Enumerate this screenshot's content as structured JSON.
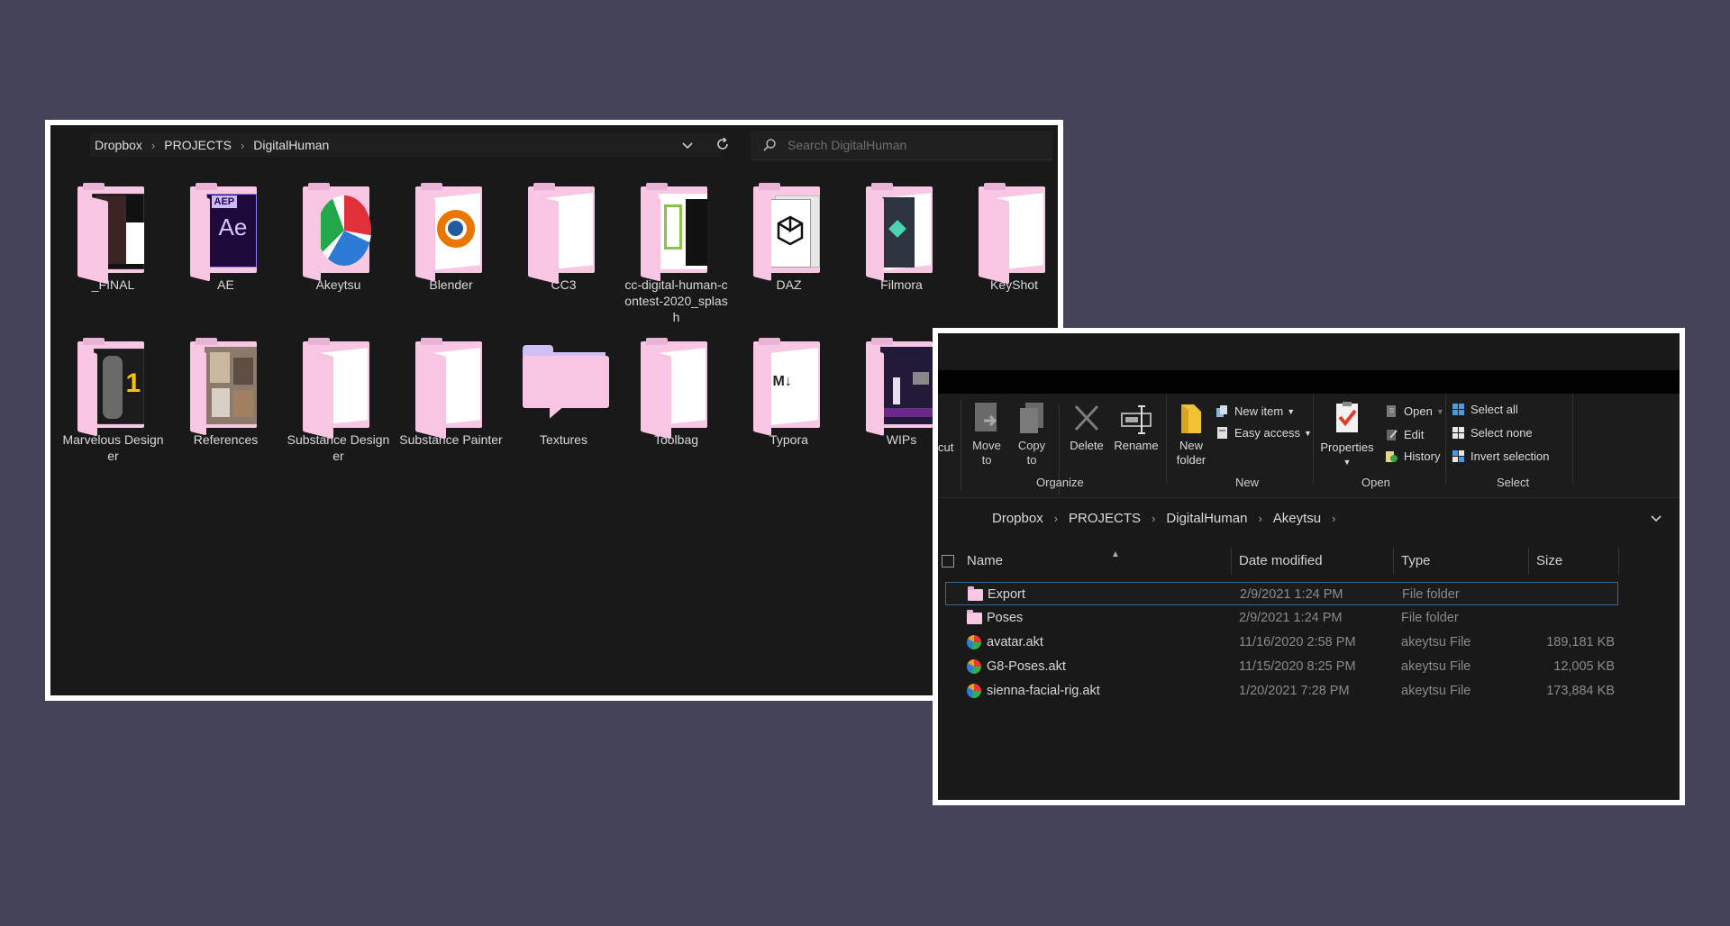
{
  "window1": {
    "breadcrumb": [
      "Dropbox",
      "PROJECTS",
      "DigitalHuman"
    ],
    "search_placeholder": "Search DigitalHuman",
    "folders": [
      {
        "label": "_FINAL",
        "icon": "folder-final-icon"
      },
      {
        "label": "AE",
        "icon": "folder-after-effects-icon"
      },
      {
        "label": "Akeytsu",
        "icon": "folder-akeytsu-icon"
      },
      {
        "label": "Blender",
        "icon": "folder-blender-icon"
      },
      {
        "label": "CC3",
        "icon": "folder-icon"
      },
      {
        "label": "cc-digital-human-contest-2020_splash",
        "icon": "folder-cc-icon"
      },
      {
        "label": "DAZ",
        "icon": "folder-daz-icon"
      },
      {
        "label": "Filmora",
        "icon": "folder-filmora-icon"
      },
      {
        "label": "KeyShot",
        "icon": "folder-icon"
      },
      {
        "label": "Marvelous Designer",
        "icon": "folder-marvelous-icon"
      },
      {
        "label": "References",
        "icon": "folder-references-icon"
      },
      {
        "label": "Substance Designer",
        "icon": "folder-icon"
      },
      {
        "label": "Substance Painter",
        "icon": "folder-icon"
      },
      {
        "label": "Textures",
        "icon": "folder-empty-icon"
      },
      {
        "label": "Toolbag",
        "icon": "folder-icon"
      },
      {
        "label": "Typora",
        "icon": "folder-markdown-icon"
      },
      {
        "label": "WIPs",
        "icon": "folder-wips-icon"
      }
    ]
  },
  "window2": {
    "ribbon": {
      "cut_label": "cut",
      "move_to": "Move\nto",
      "copy_to": "Copy\nto",
      "delete": "Delete",
      "rename": "Rename",
      "new_folder": "New\nfolder",
      "new_item": "New item",
      "easy_access": "Easy access",
      "properties": "Properties",
      "open": "Open",
      "edit": "Edit",
      "history": "History",
      "select_all": "Select all",
      "select_none": "Select none",
      "invert_selection": "Invert selection",
      "groups": [
        "Organize",
        "New",
        "Open",
        "Select"
      ]
    },
    "breadcrumb": [
      "Dropbox",
      "PROJECTS",
      "DigitalHuman",
      "Akeytsu"
    ],
    "columns": [
      "Name",
      "Date modified",
      "Type",
      "Size"
    ],
    "files": [
      {
        "name": "Export",
        "date": "2/9/2021 1:24 PM",
        "type": "File folder",
        "size": "",
        "kind": "folder",
        "selected": true
      },
      {
        "name": "Poses",
        "date": "2/9/2021 1:24 PM",
        "type": "File folder",
        "size": "",
        "kind": "folder",
        "selected": false
      },
      {
        "name": "avatar.akt",
        "date": "11/16/2020 2:58 PM",
        "type": "akeytsu File",
        "size": "189,181 KB",
        "kind": "akt",
        "selected": false
      },
      {
        "name": "G8-Poses.akt",
        "date": "11/15/2020 8:25 PM",
        "type": "akeytsu File",
        "size": "12,005 KB",
        "kind": "akt",
        "selected": false
      },
      {
        "name": "sienna-facial-rig.akt",
        "date": "1/20/2021 7:28 PM",
        "type": "akeytsu File",
        "size": "173,884 KB",
        "kind": "akt",
        "selected": false
      }
    ]
  }
}
